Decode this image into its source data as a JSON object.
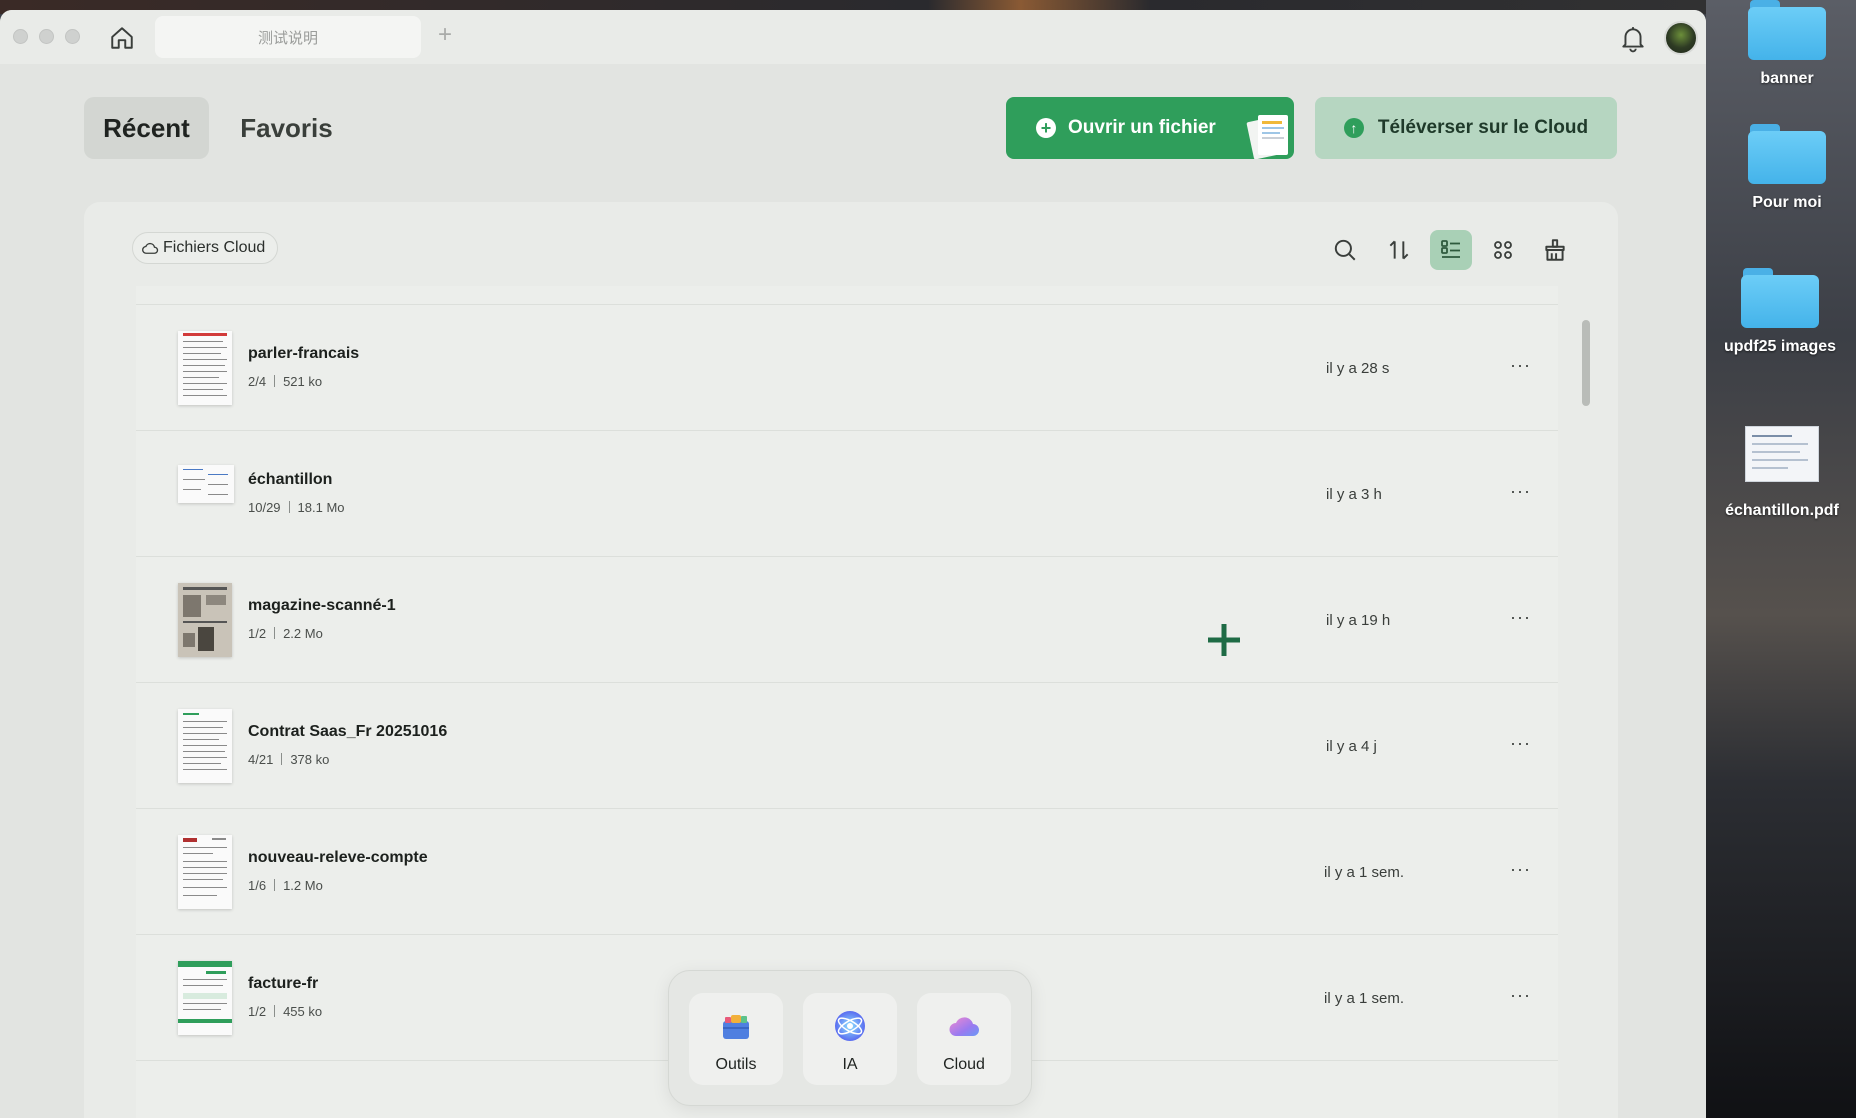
{
  "window": {
    "tab_title": "测试说明"
  },
  "header": {
    "tabs": [
      {
        "label": "Récent",
        "active": true
      },
      {
        "label": "Favoris",
        "active": false
      }
    ],
    "open_file_label": "Ouvrir un fichier",
    "upload_cloud_label": "Téléverser sur le Cloud"
  },
  "toolbar": {
    "cloud_filter_label": "Fichiers Cloud",
    "icons": [
      "search-icon",
      "sort-icon",
      "list-view-icon",
      "grid-view-icon",
      "clean-icon"
    ],
    "active_view": "list"
  },
  "files": [
    {
      "name": "parler-francais",
      "pages": "2/4",
      "size": "521 ko",
      "time": "il y a 28 s"
    },
    {
      "name": "échantillon",
      "pages": "10/29",
      "size": "18.1 Mo",
      "time": "il y a 3 h"
    },
    {
      "name": "magazine-scanné-1",
      "pages": "1/2",
      "size": "2.2 Mo",
      "time": "il y a 19 h"
    },
    {
      "name": "Contrat Saas_Fr 20251016",
      "pages": "4/21",
      "size": "378 ko",
      "time": "il y a 4 j"
    },
    {
      "name": "nouveau-releve-compte",
      "pages": "1/6",
      "size": "1.2 Mo",
      "time": "il y a 1 sem."
    },
    {
      "name": "facture-fr",
      "pages": "1/2",
      "size": "455 ko",
      "time": "il y a 1 sem."
    }
  ],
  "more_label": "···",
  "dock": {
    "items": [
      {
        "label": "Outils",
        "icon": "toolbox-icon"
      },
      {
        "label": "IA",
        "icon": "ai-icon"
      },
      {
        "label": "Cloud",
        "icon": "cloud-icon"
      }
    ]
  },
  "desktop": {
    "items": [
      {
        "label": "banner",
        "icon": "folder-icon"
      },
      {
        "label": "Pour moi",
        "icon": "folder-icon"
      },
      {
        "label": "updf25 images",
        "icon": "folder-icon"
      },
      {
        "label": "échantillon.pdf",
        "icon": "pdf-file-icon"
      }
    ]
  },
  "colors": {
    "accent_green": "#2f9e5b",
    "accent_green_light": "#b6d6c1",
    "active_view_bg": "#a9d0b6"
  }
}
